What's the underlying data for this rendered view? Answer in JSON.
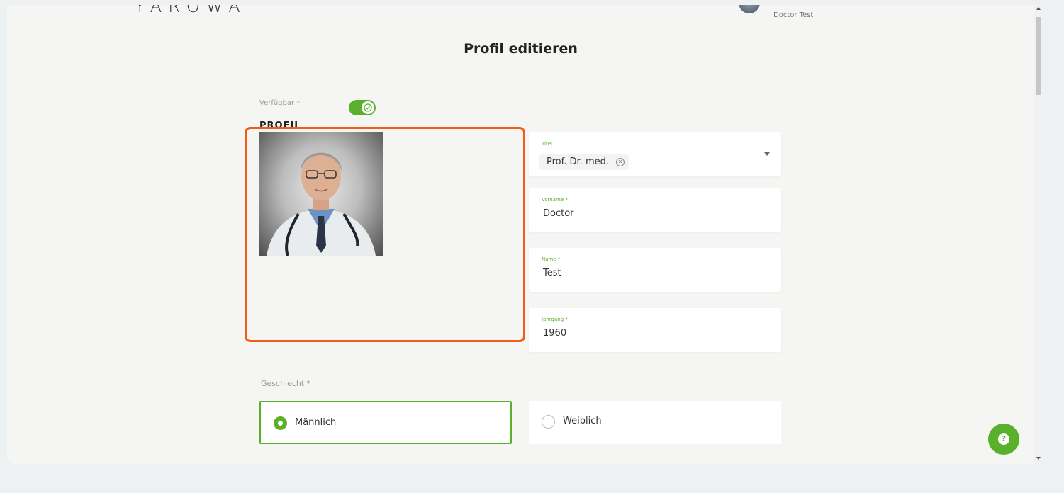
{
  "header": {
    "logo_text": "YAROWA",
    "user_name": "Doctor Test"
  },
  "page": {
    "title": "Profil editieren"
  },
  "availability": {
    "label": "Verfügbar *",
    "enabled": true
  },
  "profile_section": {
    "heading": "PROFIL"
  },
  "form": {
    "title_field": {
      "label": "Titel",
      "value": "Prof. Dr. med."
    },
    "firstname_field": {
      "label": "Vorname *",
      "value": "Doctor"
    },
    "lastname_field": {
      "label": "Name *",
      "value": "Test"
    },
    "birthyear_field": {
      "label": "Jahrgang *",
      "value": "1960"
    }
  },
  "gender": {
    "label": "Geschlecht *",
    "options": [
      {
        "label": "Männlich",
        "selected": true
      },
      {
        "label": "Weiblich",
        "selected": false
      }
    ]
  },
  "colors": {
    "accent_green": "#5bb02b",
    "highlight_orange": "#f25c13"
  },
  "icons": {
    "help": "help-icon",
    "remove_chip": "close-circle-icon",
    "dropdown": "caret-down-icon",
    "toggle_check": "check-icon"
  }
}
